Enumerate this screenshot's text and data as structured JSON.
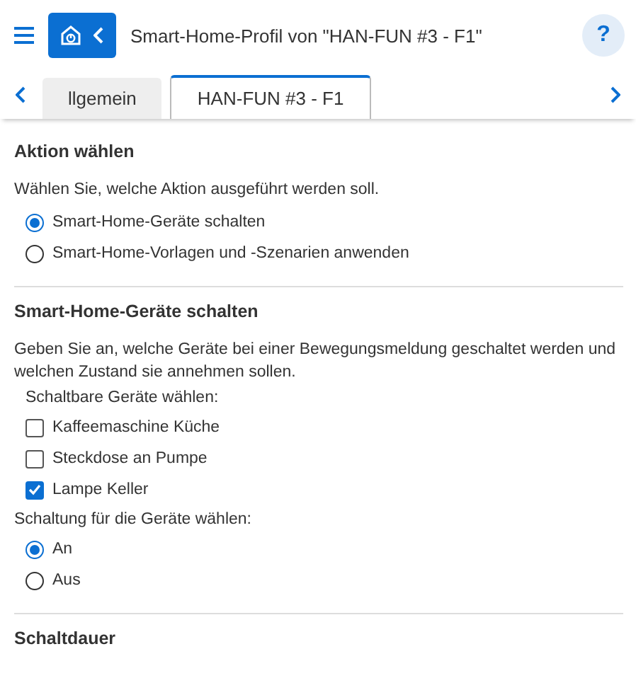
{
  "header": {
    "title": "Smart-Home-Profil von \"HAN-FUN #3 - F1\"",
    "help": "?"
  },
  "tabs": [
    {
      "label": "llgemein",
      "selected": false
    },
    {
      "label": "HAN-FUN #3 - F1",
      "selected": true
    }
  ],
  "sections": [
    {
      "heading": "Aktion wählen",
      "text": "Wählen Sie, welche Aktion ausgeführt werden soll.",
      "groups": [
        {
          "kind": "radio",
          "options": [
            {
              "label": "Smart-Home-Geräte schalten",
              "selected": true
            },
            {
              "label": "Smart-Home-Vorlagen und -Szenarien anwenden",
              "selected": false
            }
          ]
        }
      ]
    },
    {
      "heading": "Smart-Home-Geräte schalten",
      "text": "Geben Sie an, welche Geräte bei einer Bewegungsmeldung geschaltet werden und welchen Zustand sie annehmen sollen.",
      "groups": [
        {
          "kind": "checkbox",
          "label": "Schaltbare Geräte wählen:",
          "options": [
            {
              "label": "Kaffeemaschine Küche",
              "checked": false
            },
            {
              "label": "Steckdose an Pumpe",
              "checked": false
            },
            {
              "label": "Lampe Keller",
              "checked": true
            }
          ]
        },
        {
          "kind": "radio",
          "label": "Schaltung für die Geräte wählen:",
          "outdent": true,
          "options": [
            {
              "label": "An",
              "selected": true
            },
            {
              "label": "Aus",
              "selected": false
            }
          ]
        }
      ]
    },
    {
      "heading": "Schaltdauer"
    }
  ]
}
